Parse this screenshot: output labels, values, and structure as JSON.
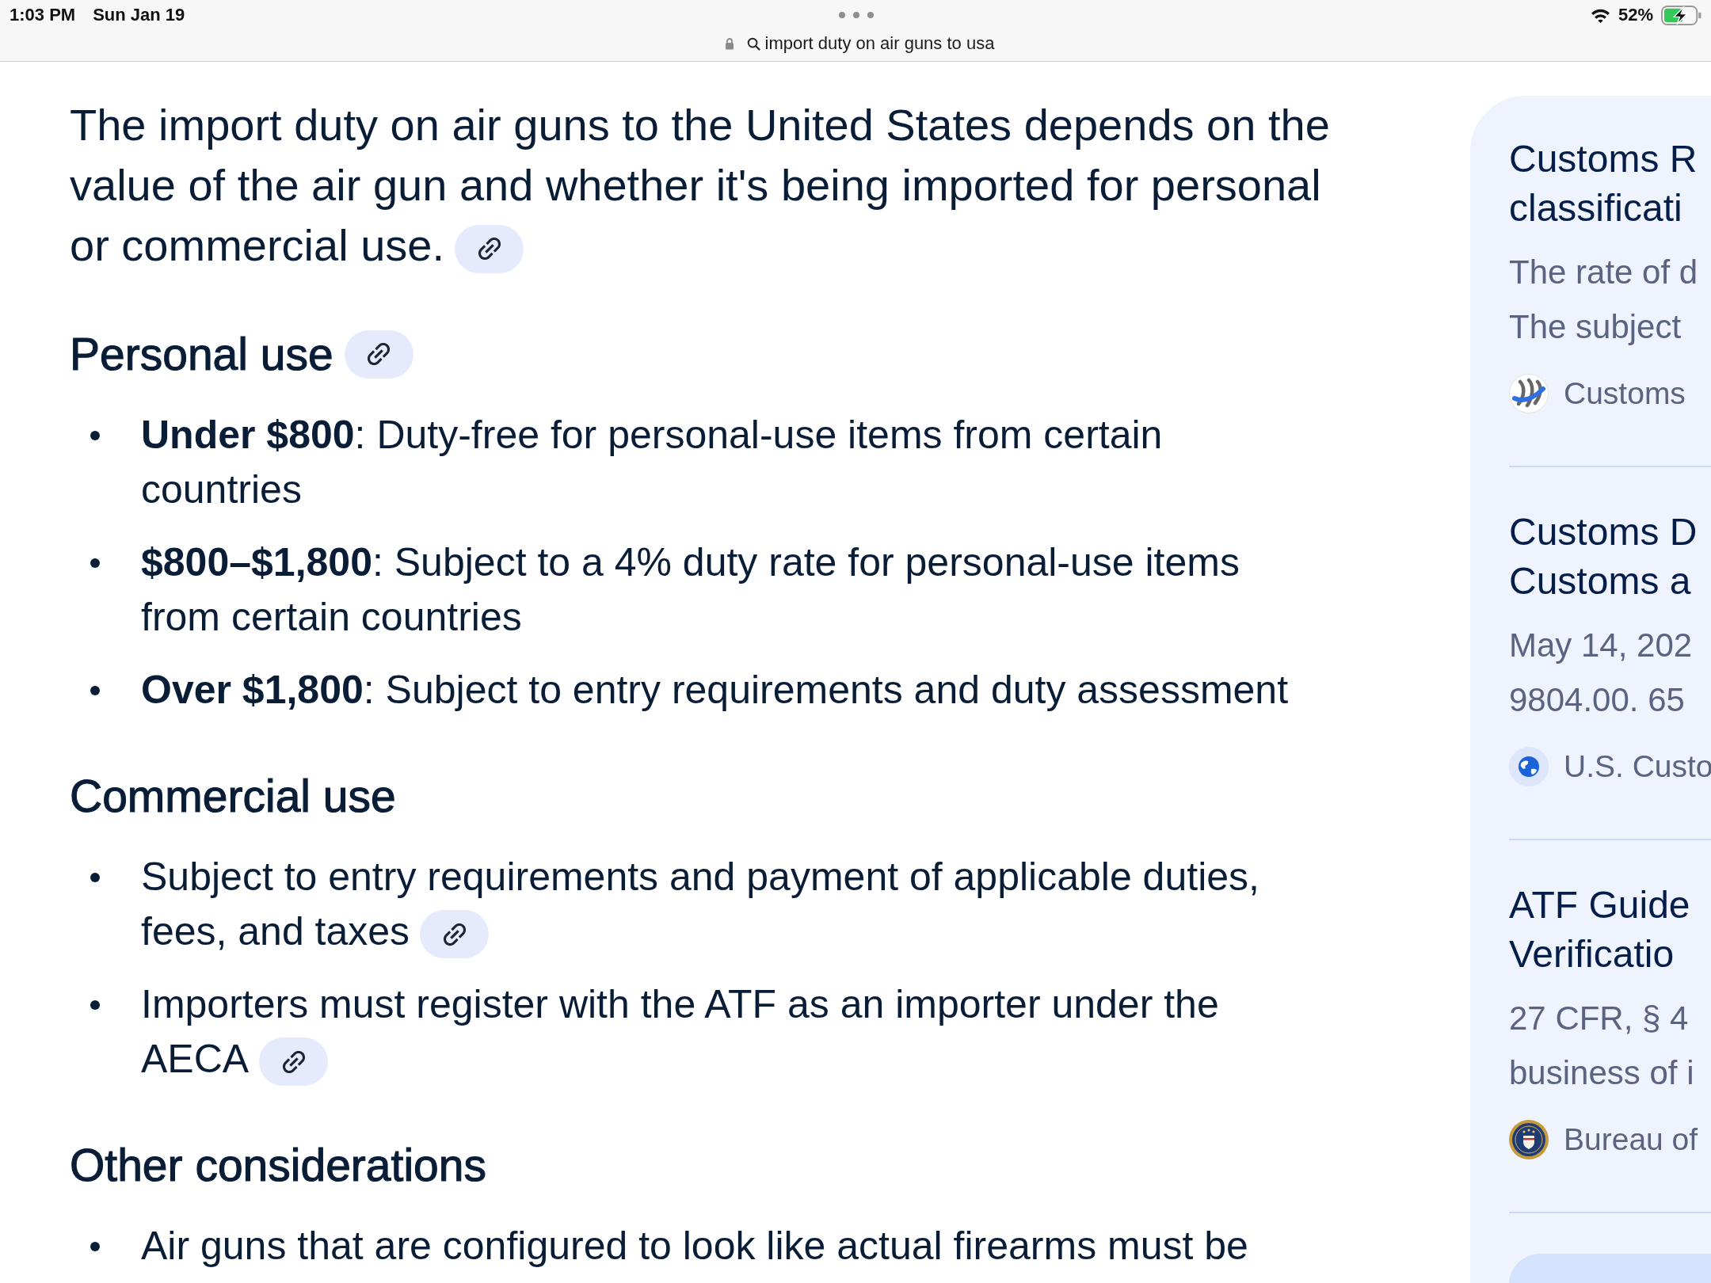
{
  "status_bar": {
    "time": "1:03 PM",
    "date": "Sun Jan 19",
    "battery_percent": "52%",
    "charging": true
  },
  "address_bar": {
    "query": "import duty on air guns to usa"
  },
  "answer": {
    "intro": {
      "text": "The import duty on air guns to the United States depends on the value of the air gun and whether it's being imported for personal or commercial use.",
      "cited": true
    },
    "sections": [
      {
        "heading": "Personal use",
        "cited": true,
        "items": [
          {
            "text": "**Under $800**: Duty-free for personal-use items from certain countries",
            "cited": false
          },
          {
            "text": "**$800–$1,800**: Subject to a 4% duty rate for personal-use items from certain countries",
            "cited": false
          },
          {
            "text": "**Over $1,800**: Subject to entry requirements and duty assessment",
            "cited": false
          }
        ]
      },
      {
        "heading": "Commercial use",
        "cited": false,
        "items": [
          {
            "text": "Subject to entry requirements and payment of applicable duties, fees, and taxes",
            "cited": true
          },
          {
            "text": "Importers must register with the ATF as an importer under the AECA",
            "cited": true
          }
        ]
      },
      {
        "heading": "Other considerations",
        "cited": false,
        "items": [
          {
            "text": "Air guns that are configured to look like actual firearms must be",
            "cited": false
          }
        ]
      }
    ]
  },
  "sources_panel": {
    "cards": [
      {
        "title_lines": [
          "Customs R",
          "classificati"
        ],
        "snippet_lines": [
          "The rate of d",
          "The subject"
        ],
        "source": "Customs",
        "kind": "logo"
      },
      {
        "title_lines": [
          "Customs D",
          "Customs a"
        ],
        "snippet_lines": [
          "May 14, 202",
          "9804.00. 65"
        ],
        "source": "U.S. Custo",
        "kind": "globe"
      },
      {
        "title_lines": [
          "ATF Guide",
          "Verificatio"
        ],
        "snippet_lines": [
          "27 CFR, § 4",
          "business of i"
        ],
        "source": "Bureau of",
        "kind": "seal"
      }
    ]
  }
}
